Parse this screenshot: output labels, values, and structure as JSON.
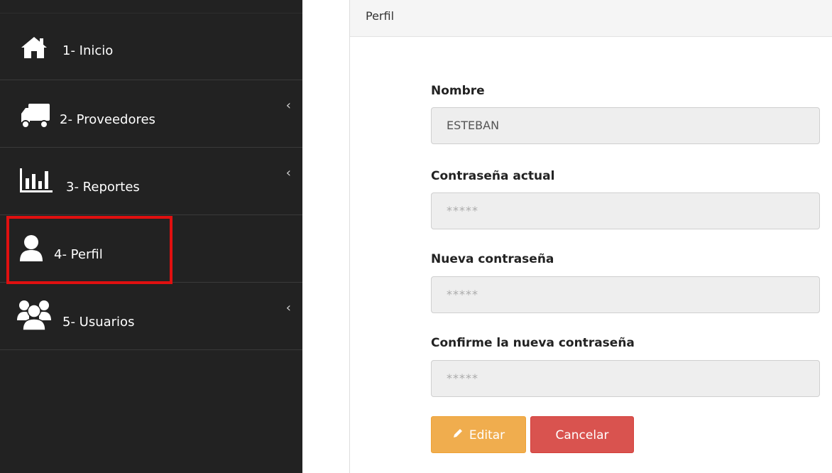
{
  "sidebar": {
    "items": [
      {
        "label": "1- Inicio",
        "icon": "home-icon",
        "has_submenu": false
      },
      {
        "label": "2- Proveedores",
        "icon": "truck-icon",
        "has_submenu": true
      },
      {
        "label": "3- Reportes",
        "icon": "bar-chart-icon",
        "has_submenu": true
      },
      {
        "label": "4- Perfil",
        "icon": "user-icon",
        "has_submenu": false,
        "highlighted": true
      },
      {
        "label": "5- Usuarios",
        "icon": "users-icon",
        "has_submenu": true
      }
    ],
    "chevron": "‹"
  },
  "panel": {
    "title": "Perfil"
  },
  "form": {
    "name_label": "Nombre",
    "name_value": "ESTEBAN",
    "current_password_label": "Contraseña actual",
    "current_password_placeholder": "*****",
    "new_password_label": "Nueva contraseña",
    "new_password_placeholder": "*****",
    "confirm_password_label": "Confirme la nueva contraseña",
    "confirm_password_placeholder": "*****"
  },
  "buttons": {
    "edit_label": "Editar",
    "edit_icon": "pencil-icon",
    "cancel_label": "Cancelar"
  },
  "colors": {
    "sidebar_bg": "#222222",
    "highlight_border": "#e01010",
    "edit_button": "#f0ad4e",
    "cancel_button": "#d9534f"
  }
}
